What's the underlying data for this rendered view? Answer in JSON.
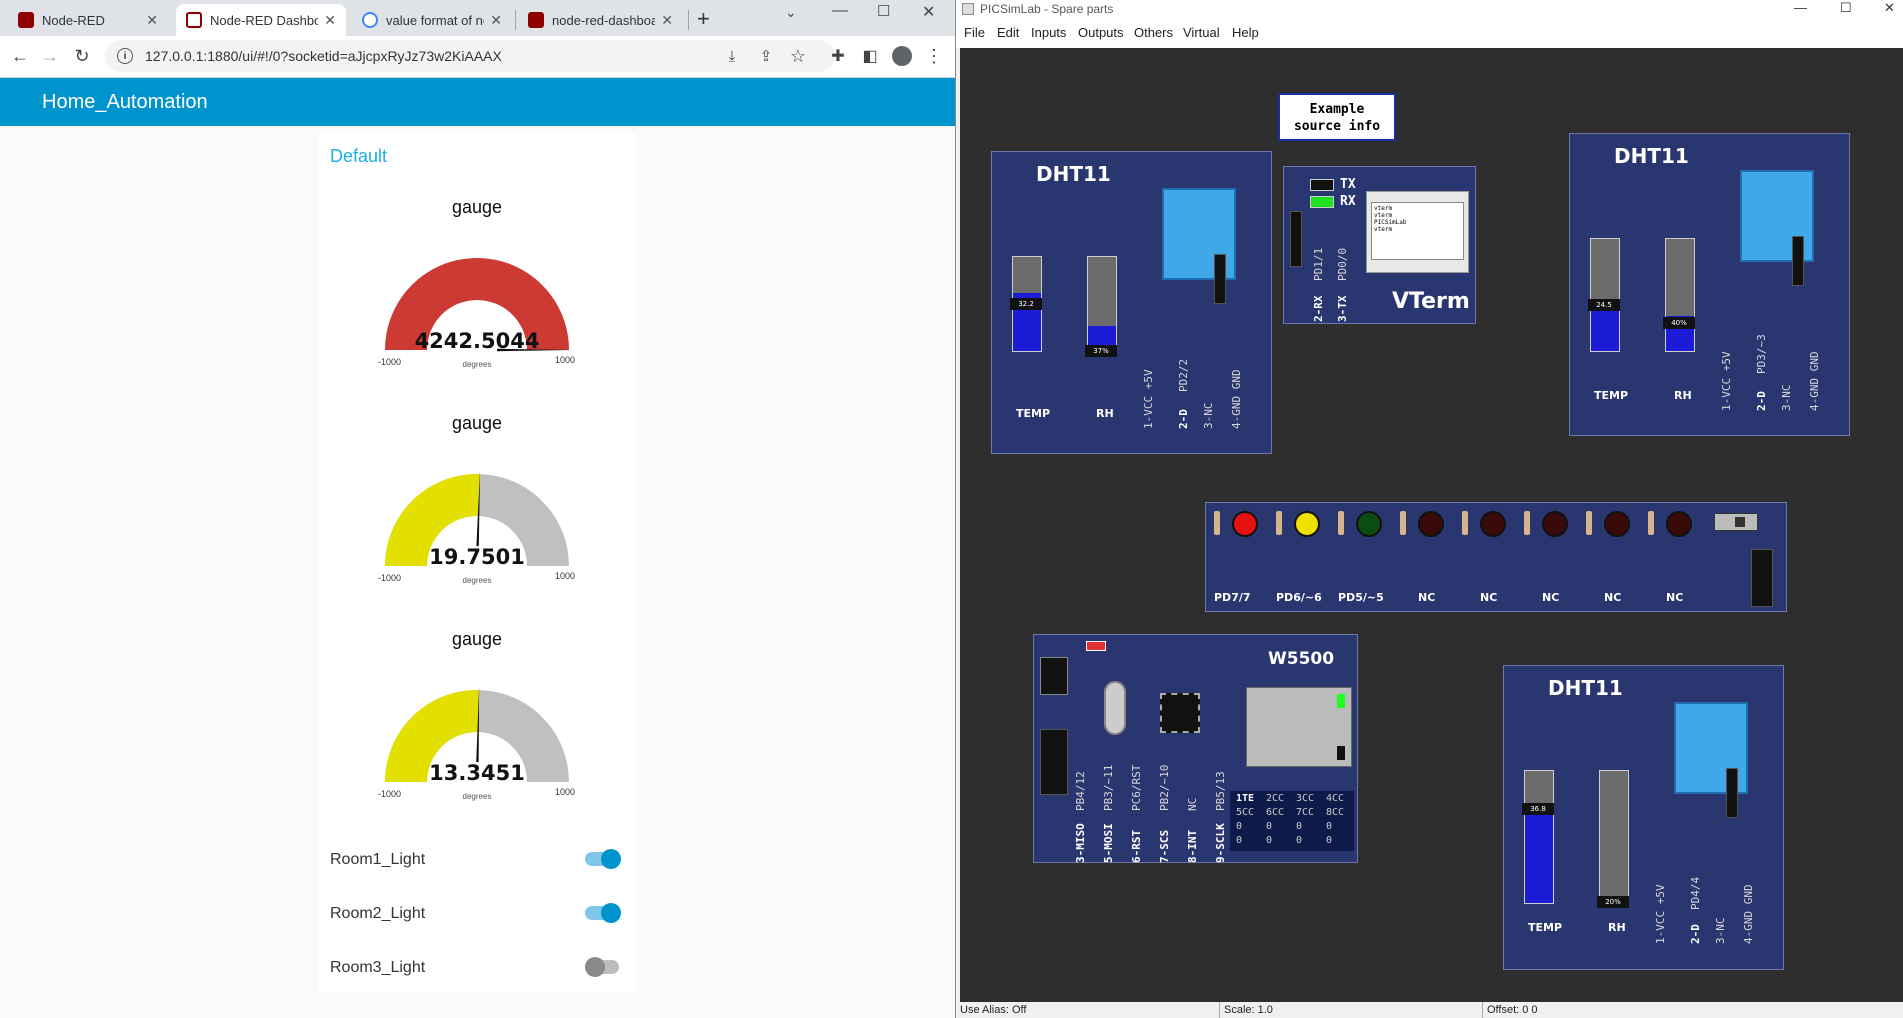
{
  "browser": {
    "tabs": [
      {
        "label": "Node-RED",
        "active": false
      },
      {
        "label": "Node-RED Dashboa",
        "active": true
      },
      {
        "label": "value format of noc",
        "active": false
      },
      {
        "label": "node-red-dashboar",
        "active": false
      }
    ],
    "new_tab_symbol": "+",
    "url": "127.0.0.1:1880/ui/#!/0?socketid=aJjcpxRyJz73w2KiAAAX"
  },
  "dashboard": {
    "title": "Home_Automation",
    "group": "Default",
    "gauges": [
      {
        "title": "gauge",
        "value": "4242.5044",
        "units": "degrees",
        "min": "-1000",
        "max": "1000",
        "fill": 1.0,
        "color": "#cc3a33"
      },
      {
        "title": "gauge",
        "value": "19.7501",
        "units": "degrees",
        "min": "-1000",
        "max": "1000",
        "fill": 0.51,
        "color": "#e3e000"
      },
      {
        "title": "gauge",
        "value": "13.3451",
        "units": "degrees",
        "min": "-1000",
        "max": "1000",
        "fill": 0.507,
        "color": "#e3e000"
      }
    ],
    "switches": [
      {
        "label": "Room1_Light",
        "on": true
      },
      {
        "label": "Room2_Light",
        "on": true
      },
      {
        "label": "Room3_Light",
        "on": false
      }
    ]
  },
  "sim": {
    "title": "PICSimLab - Spare parts",
    "window_controls": [
      "—",
      "☐",
      "✕"
    ],
    "menu": [
      "File",
      "Edit",
      "Inputs",
      "Outputs",
      "Others",
      "Virtual",
      "Help"
    ],
    "note": [
      "Example",
      "source info"
    ],
    "dht1": {
      "title": "DHT11",
      "temp": "32.2",
      "temp_level": 0.62,
      "rh": "37%",
      "rh_level": 0.27,
      "temp_label": "TEMP",
      "rh_label": "RH",
      "pins": [
        "1-VCC +5V",
        "2-D",
        "PD2/2",
        "3-NC",
        "4-GND GND"
      ]
    },
    "dht2": {
      "title": "DHT11",
      "temp": "24.5",
      "temp_level": 0.43,
      "rh": "40%",
      "rh_level": 0.31,
      "temp_label": "TEMP",
      "rh_label": "RH",
      "pins": [
        "1-VCC +5V",
        "2-D",
        "PD3/~3",
        "3-NC",
        "4-GND GND"
      ]
    },
    "dht3": {
      "title": "DHT11",
      "temp": "36.8",
      "temp_level": 0.7,
      "rh": "20%",
      "rh_level": 0.04,
      "temp_label": "TEMP",
      "rh_label": "RH",
      "pins": [
        "1-VCC +5V",
        "2-D",
        "PD4/4",
        "3-NC",
        "4-GND GND"
      ]
    },
    "vterm": {
      "title": "VTerm",
      "tx": "TX",
      "rx": "RX",
      "pins": [
        "2-RX",
        "PD1/1",
        "3-TX",
        "PD0/0"
      ],
      "screen_lines": [
        "vterm",
        "vterm",
        "PICSimLab",
        "vterm"
      ]
    },
    "leds": {
      "colors": [
        "#e81010",
        "#f0e000",
        "#0a4d12",
        "#3a0a0a",
        "#3a0a0a",
        "#3a0a0a",
        "#3a0a0a",
        "#3a0a0a"
      ],
      "labels": [
        "PD7/7",
        "PD6/~6",
        "PD5/~5",
        "NC",
        "NC",
        "NC",
        "NC",
        "NC"
      ]
    },
    "w5500": {
      "title": "W5500",
      "pins": [
        "3-MISO",
        "PB4/12",
        "5-MOSI",
        "PB3/~11",
        "6-RST",
        "PC6/RST",
        "7-SCS",
        "PB2/~10",
        "8-INT",
        "NC",
        "9-SCLK",
        "PB5/13"
      ],
      "table": [
        [
          "1TE",
          "2CC",
          "3CC",
          "4CC"
        ],
        [
          "5CC",
          "6CC",
          "7CC",
          "8CC"
        ],
        [
          "0",
          "0",
          "0",
          "0"
        ],
        [
          "0",
          "0",
          "0",
          "0"
        ]
      ]
    },
    "status": {
      "alias": "Use Alias: Off",
      "scale": "Scale: 1.0",
      "offset": "Offset:  0  0"
    }
  }
}
